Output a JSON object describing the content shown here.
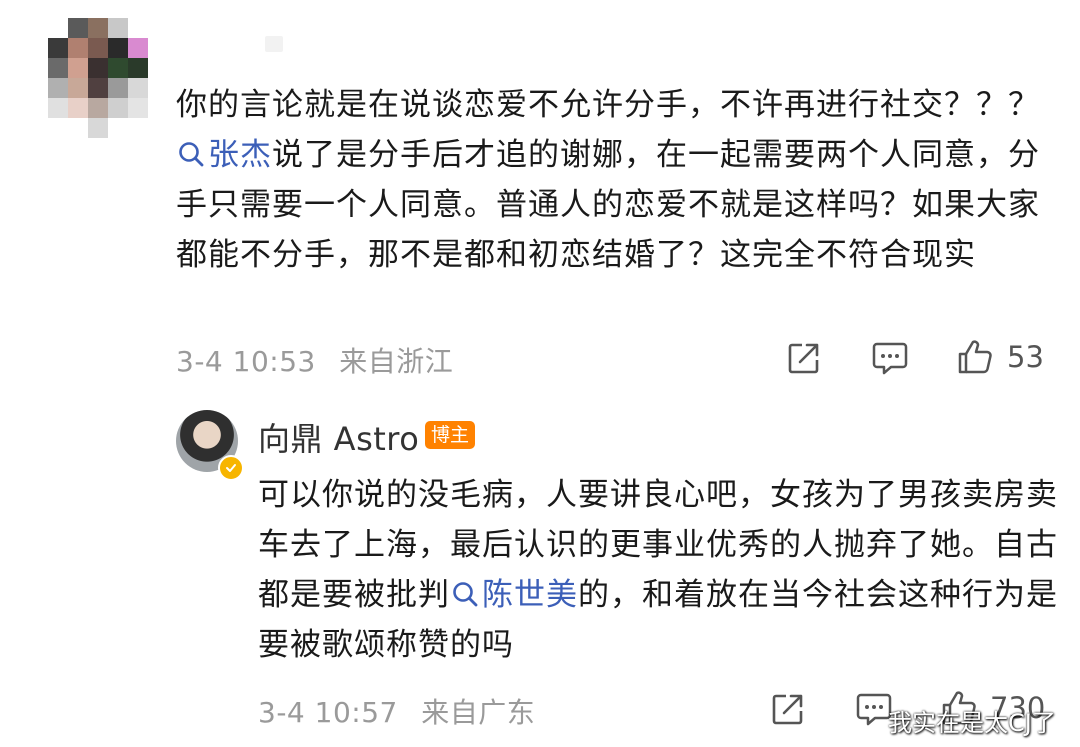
{
  "comment": {
    "text_line1": "你的言论就是在说谈恋爱不允许分手，不许再进行社交？？？",
    "topic": "张杰",
    "text_after_topic": "说了是分手后才追的谢娜，在一起需要两个人同意，分手只需要一个人同意。普通人的恋爱不就是这样吗？如果大家都能不分手，那不是都和初恋结婚了？这完全不符合现实",
    "time": "3-4 10:53",
    "location": "来自浙江",
    "likes": "53",
    "icons": [
      "share-icon",
      "comment-icon",
      "like-icon"
    ]
  },
  "reply": {
    "author": "向鼎 Astro",
    "badge": "博主",
    "text_before_topic": "可以你说的没毛病，人要讲良心吧，女孩为了男孩卖房卖车去了上海，最后认识的更事业优秀的人抛弃了她。自古都是要被批判",
    "topic": "陈世美",
    "text_after_topic": "的，和着放在当今社会这种行为是要被歌颂称赞的吗",
    "time": "3-4 10:57",
    "location": "来自广东",
    "likes": "730",
    "icons": [
      "share-icon",
      "comment-icon",
      "like-icon",
      "verified-badge-icon"
    ]
  },
  "watermark": "我实在是太CJ了",
  "colors": {
    "topic_link": "#3c5fb8",
    "meta_gray": "#9a9a9a",
    "badge_orange": "#ff8200",
    "verify_yellow": "#f7b500"
  }
}
